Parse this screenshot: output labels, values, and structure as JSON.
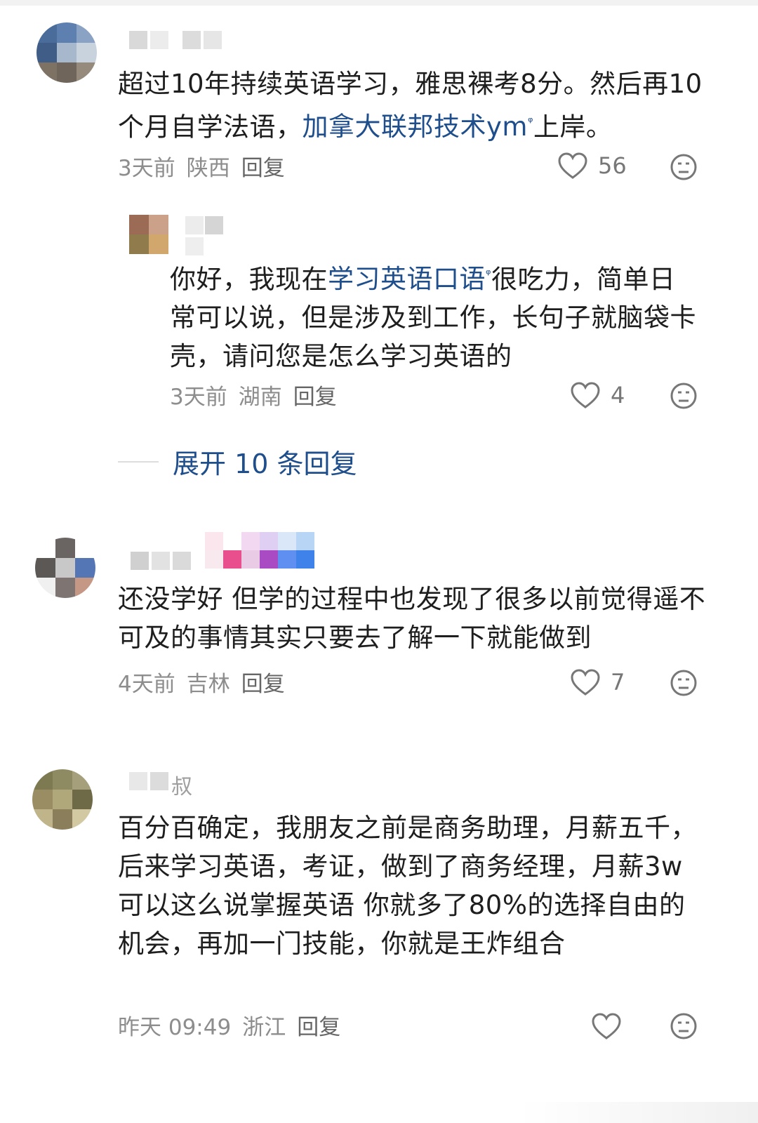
{
  "comments": [
    {
      "text_before": "超过10年持续英语学习，雅思裸考8分。然后再10个月自学法语，",
      "link_text": "加拿大联邦技术ym",
      "link_sup": "ᵠ",
      "text_after": "上岸。",
      "time": "3天前",
      "location": "陕西",
      "reply_label": "回复",
      "likes": "56"
    },
    {
      "text_before": "你好，我现在",
      "link_text": "学习英语口语",
      "link_sup": "ᵠ",
      "text_after": "很吃力，简单日常可以说，但是涉及到工作，长句子就脑袋卡壳，请问您是怎么学习英语的",
      "time": "3天前",
      "location": "湖南",
      "reply_label": "回复",
      "likes": "4"
    },
    {
      "expand_label": "展开 10 条回复"
    },
    {
      "text": "还没学好 但学的过程中也发现了很多以前觉得遥不可及的事情其实只要去了解一下就能做到",
      "time": "4天前",
      "location": "吉林",
      "reply_label": "回复",
      "likes": "7"
    },
    {
      "partial_name": "叔",
      "text": "百分百确定，我朋友之前是商务助理，月薪五千，后来学习英语，考证，做到了商务经理，月薪3w 可以这么说掌握英语 你就多了80%的选择自由的机会，再加一门技能，你就是王炸组合",
      "time": "昨天 09:49",
      "location": "浙江",
      "reply_label": "回复"
    }
  ],
  "colors": {
    "link": "#1f4e8c",
    "meta": "#8d8d8d",
    "text": "#1e1e1e"
  },
  "icons": [
    "heart-icon",
    "dislike-face-icon"
  ]
}
